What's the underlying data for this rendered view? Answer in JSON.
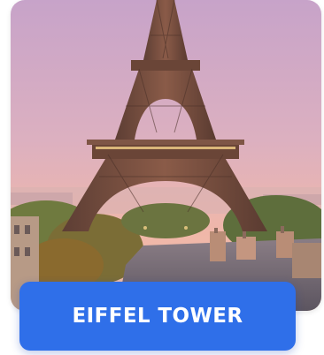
{
  "card": {
    "title": "EIFFEL TOWER",
    "image_subject": "eiffel-tower-photo",
    "colors": {
      "button_bg": "#2f6fe9",
      "sky_top": "#c9a2c8",
      "sky_bottom": "#f2b7a6",
      "tower": "#6f4a3c"
    }
  }
}
